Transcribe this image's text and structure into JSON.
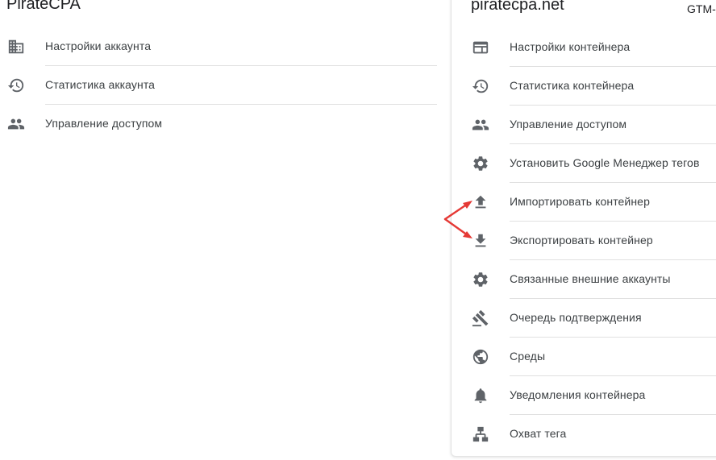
{
  "account": {
    "title": "PirateCPA",
    "items": [
      {
        "label": "Настройки аккаунта",
        "icon": "building-icon"
      },
      {
        "label": "Статистика аккаунта",
        "icon": "history-icon"
      },
      {
        "label": "Управление доступом",
        "icon": "people-icon"
      }
    ]
  },
  "container": {
    "title": "piratecpa.net",
    "id_fragment": "GTM-I",
    "items": [
      {
        "label": "Настройки контейнера",
        "icon": "container-icon"
      },
      {
        "label": "Статистика контейнера",
        "icon": "history-icon"
      },
      {
        "label": "Управление доступом",
        "icon": "people-icon"
      },
      {
        "label": "Установить Google Менеджер тегов",
        "icon": "gear-icon"
      },
      {
        "label": "Импортировать контейнер",
        "icon": "upload-icon"
      },
      {
        "label": "Экспортировать контейнер",
        "icon": "download-icon"
      },
      {
        "label": "Связанные внешние аккаунты",
        "icon": "gear-icon"
      },
      {
        "label": "Очередь подтверждения",
        "icon": "gavel-icon"
      },
      {
        "label": "Среды",
        "icon": "globe-icon"
      },
      {
        "label": "Уведомления контейнера",
        "icon": "bell-icon"
      },
      {
        "label": "Охват тега",
        "icon": "hierarchy-icon"
      }
    ]
  },
  "colors": {
    "icon": "#5f6368",
    "text": "#3c4043",
    "divider": "#e0e0e0",
    "annotation_arrow": "#e53935"
  }
}
